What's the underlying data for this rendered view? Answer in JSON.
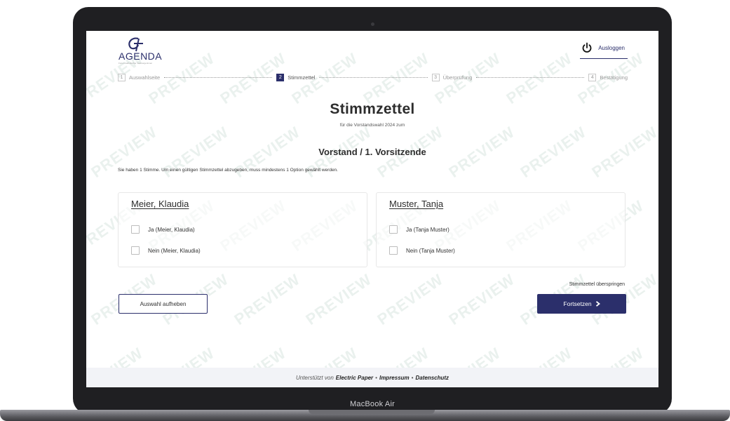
{
  "device": {
    "label": "MacBook Air"
  },
  "header": {
    "logo_text": "AGENDA",
    "logo_subtext": "Forum katholischer Seelsorgerinnen",
    "logout_label": "Ausloggen"
  },
  "stepper": {
    "steps": [
      {
        "number": "1",
        "label": "Auswahlseite",
        "active": false
      },
      {
        "number": "2",
        "label": "Stimmzettel",
        "active": true
      },
      {
        "number": "3",
        "label": "Überprüfung",
        "active": false
      },
      {
        "number": "4",
        "label": "Bestätigung",
        "active": false
      }
    ]
  },
  "ballot": {
    "title": "Stimmzettel",
    "subtitle": "für die Vorstandswahl 2024 zum",
    "position": "Vorstand / 1. Vorsitzende",
    "instructions": "Sie haben 1 Stimme. Um einen gültigen Stimmzettel abzugeben, muss mindestens 1 Option gewählt werden."
  },
  "candidates": [
    {
      "name": "Meier, Klaudia",
      "options": [
        {
          "label": "Ja (Meier, Klaudia)",
          "checked": false
        },
        {
          "label": "Nein (Meier, Klaudia)",
          "checked": false
        }
      ]
    },
    {
      "name": "Muster, Tanja",
      "options": [
        {
          "label": "Ja (Tanja Muster)",
          "checked": false
        },
        {
          "label": "Nein (Tanja Muster)",
          "checked": false
        }
      ]
    }
  ],
  "actions": {
    "clear_label": "Auswahl aufheben",
    "skip_label": "Stimmzettel überspringen",
    "continue_label": "Fortsetzen"
  },
  "footer": {
    "prefix": "Unterstützt von",
    "brand": "Electric Paper",
    "sep1": "•",
    "impressum": "Impressum",
    "sep2": "•",
    "datenschutz": "Datenschutz"
  },
  "watermark": {
    "text": "PREVIEW"
  },
  "colors": {
    "primary": "#2b2f6b",
    "footer_bg": "#f2f3f7"
  }
}
